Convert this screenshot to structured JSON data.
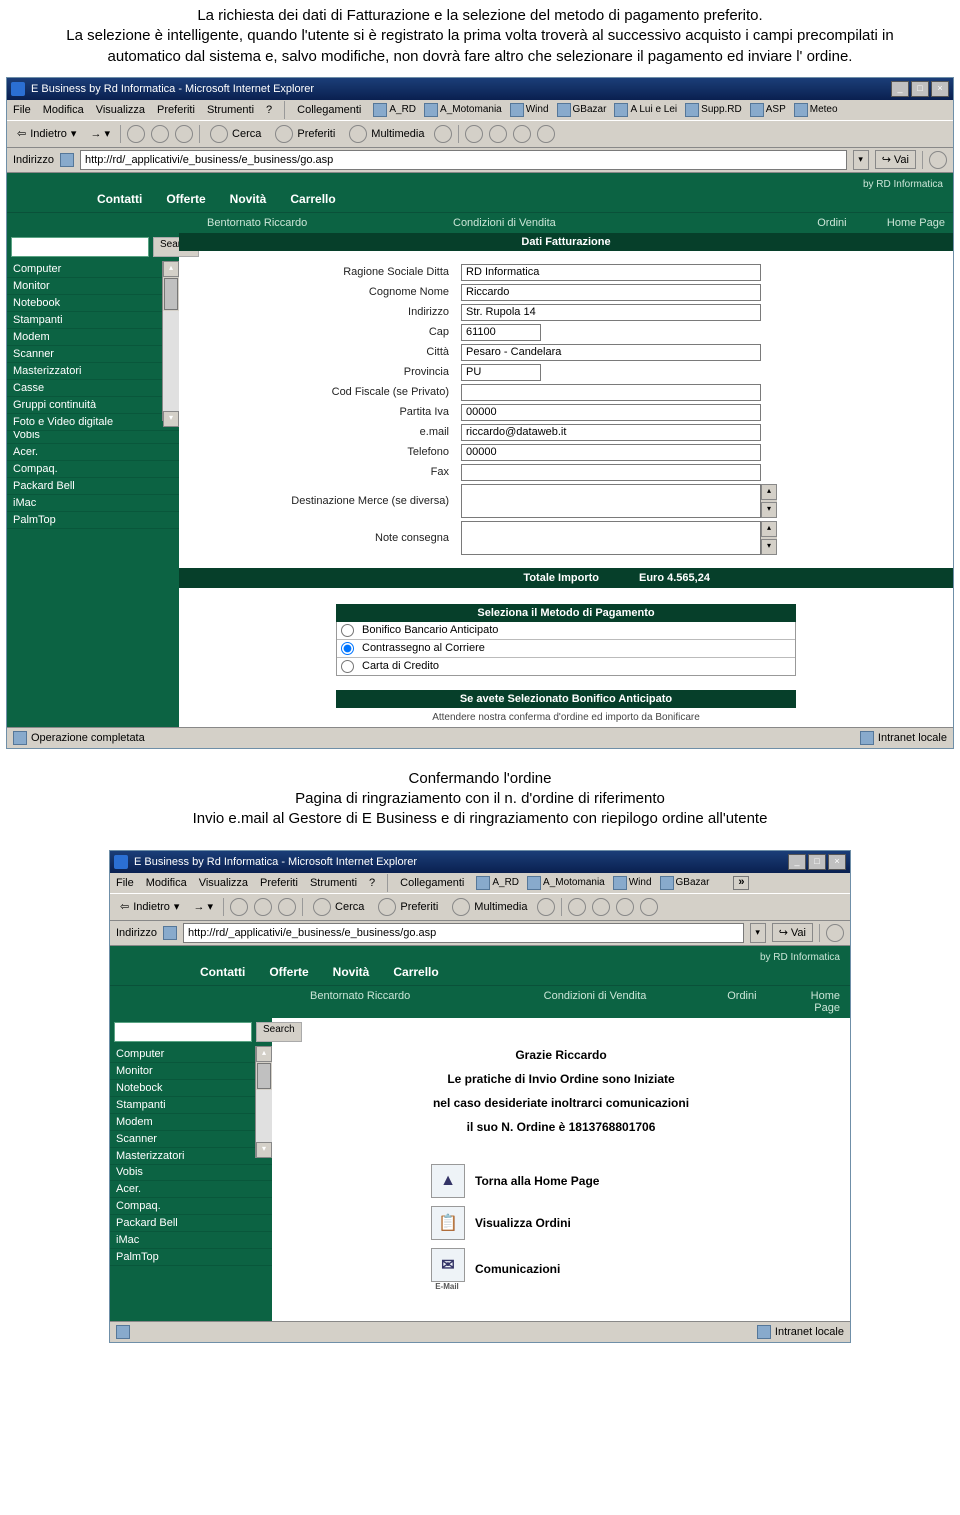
{
  "intro": {
    "p1": "La richiesta dei dati di Fatturazione e la selezione del metodo di pagamento preferito.",
    "p2": "La selezione è intelligente, quando l'utente si è registrato la prima volta troverà al successivo acquisto i campi precompilati in automatico dal sistema e, salvo modifiche, non dovrà fare altro che selezionare il pagamento ed inviare l' ordine."
  },
  "browser": {
    "title": "E Business by Rd Informatica - Microsoft Internet Explorer",
    "menus": [
      "File",
      "Modifica",
      "Visualizza",
      "Preferiti",
      "Strumenti",
      "?"
    ],
    "links_label": "Collegamenti",
    "links": [
      "A_RD",
      "A_Motomania",
      "Wind",
      "GBazar",
      "A Lui e Lei",
      "Supp.RD",
      "ASP",
      "Meteo"
    ],
    "links2": [
      "A_RD",
      "A_Motomania",
      "Wind",
      "GBazar"
    ],
    "back": "Indietro",
    "search": "Cerca",
    "fav": "Preferiti",
    "media": "Multimedia",
    "addr_label": "Indirizzo",
    "addr_value": "http://rd/_applicativi/e_business/e_business/go.asp",
    "go": "Vai",
    "status_done": "Operazione completata",
    "status_zone": "Intranet locale"
  },
  "nav": {
    "tabs": [
      "Contatti",
      "Offerte",
      "Novità",
      "Carrello"
    ],
    "byline": "by RD Informatica",
    "welcome": "Bentornato Riccardo",
    "cond": "Condizioni di Vendita",
    "ordini": "Ordini",
    "home": "Home Page",
    "search_btn": "Search"
  },
  "categories1": [
    "Computer",
    "Monitor",
    "Notebook",
    "Stampanti",
    "Modem",
    "Scanner",
    "Masterizzatori",
    "Casse",
    "Gruppi continuità",
    "Foto e Video digitale"
  ],
  "brands": [
    "Vobis",
    "Acer.",
    "Compaq.",
    "Packard Bell",
    "iMac",
    "PalmTop"
  ],
  "categories2": [
    "Computer",
    "Monitor",
    "Notebock",
    "Stampanti",
    "Modem",
    "Scanner",
    "Masterizzatori"
  ],
  "form": {
    "header": "Dati Fatturazione",
    "labels": {
      "ragione": "Ragione Sociale Ditta",
      "cognome": "Cognome Nome",
      "indirizzo": "Indirizzo",
      "cap": "Cap",
      "citta": "Città",
      "provincia": "Provincia",
      "cf": "Cod Fiscale (se Privato)",
      "piva": "Partita Iva",
      "email": "e.mail",
      "tel": "Telefono",
      "fax": "Fax",
      "dest": "Destinazione Merce (se diversa)",
      "note": "Note consegna"
    },
    "values": {
      "ragione": "RD Informatica",
      "cognome": "Riccardo",
      "indirizzo": "Str. Rupola 14",
      "cap": "61100",
      "citta": "Pesaro - Candelara",
      "provincia": "PU",
      "cf": "",
      "piva": "00000",
      "email": "riccardo@dataweb.it",
      "tel": "00000",
      "fax": "",
      "dest": "",
      "note": ""
    }
  },
  "total": {
    "label": "Totale Importo",
    "value": "Euro 4.565,24"
  },
  "payment": {
    "header": "Seleziona il Metodo di Pagamento",
    "options": [
      "Bonifico Bancario Anticipato",
      "Contrassegno al Corriere",
      "Carta di Credito"
    ],
    "selected": 1,
    "notice": "Se avete Selezionato Bonifico Anticipato",
    "sub": "Attendere nostra conferma d'ordine ed importo da Bonificare"
  },
  "caption2": {
    "l1": "Confermando l'ordine",
    "l2": "Pagina di ringraziamento con il n. d'ordine di riferimento",
    "l3": "Invio e.mail al Gestore di E Business e di ringraziamento con riepilogo ordine all'utente"
  },
  "thanks": {
    "greet": "Grazie Riccardo",
    "line1": "Le pratiche di Invio Ordine sono Iniziate",
    "line2": "nel caso desideriate inoltrarci comunicazioni",
    "line3": "il suo N. Ordine è 1813768801706",
    "actions": [
      "Torna alla Home Page",
      "Visualizza Ordini",
      "Comunicazioni"
    ],
    "email_label": "E-Mail"
  }
}
